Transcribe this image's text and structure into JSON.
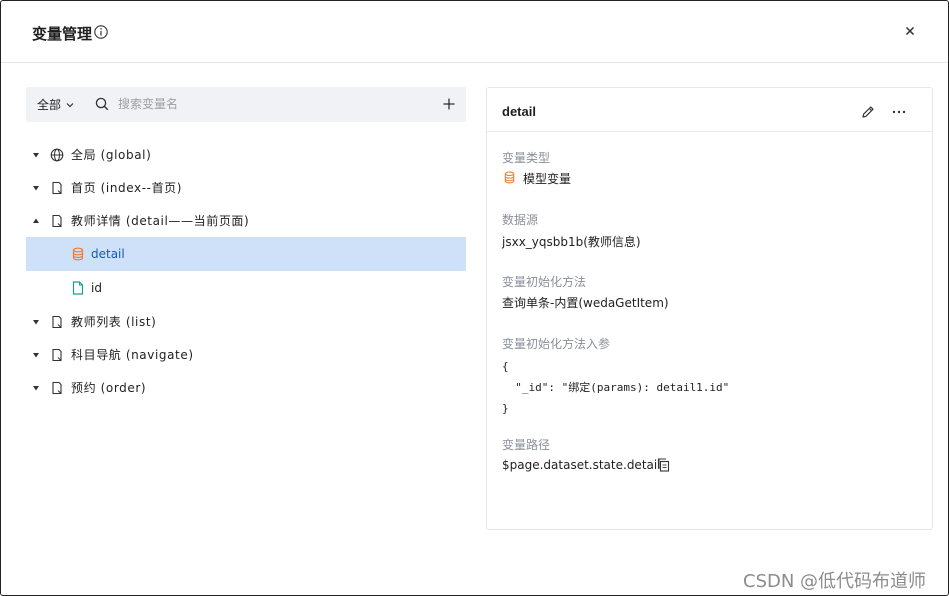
{
  "header": {
    "title": "变量管理"
  },
  "toolbar": {
    "scope": "全部",
    "search_placeholder": "搜索变量名"
  },
  "tree": {
    "items": [
      {
        "label": "全局 (global)",
        "icon": "globe-icon",
        "expanded": true
      },
      {
        "label": "首页 (index--首页)",
        "icon": "page-icon",
        "expanded": true
      },
      {
        "label": "教师详情 (detail——当前页面)",
        "icon": "page-icon",
        "expanded": false
      },
      {
        "label": "detail",
        "icon": "database-icon",
        "selected": true
      },
      {
        "label": "id",
        "icon": "file-icon"
      },
      {
        "label": "教师列表 (list)",
        "icon": "page-icon",
        "expanded": true
      },
      {
        "label": "科目导航 (navigate)",
        "icon": "page-icon",
        "expanded": true
      },
      {
        "label": "预约 (order)",
        "icon": "page-icon",
        "expanded": true
      }
    ]
  },
  "detail": {
    "title": "detail",
    "type_label": "变量类型",
    "type_value": "模型变量",
    "source_label": "数据源",
    "source_value": "jsxx_yqsbb1b(教师信息)",
    "init_label": "变量初始化方法",
    "init_value": "查询单条-内置(wedaGetItem)",
    "params_label": "变量初始化方法入参",
    "params_code": "{\n  \"_id\": \"绑定(params): detail1.id\"\n}",
    "path_label": "变量路径",
    "path_value": "$page.dataset.state.detail"
  },
  "watermark": "CSDN @低代码布道师",
  "colors": {
    "selected_bg": "#cfe1f9",
    "selected_text": "#1558c0",
    "model_icon": "#e8803a",
    "file_icon": "#1aa08c"
  }
}
